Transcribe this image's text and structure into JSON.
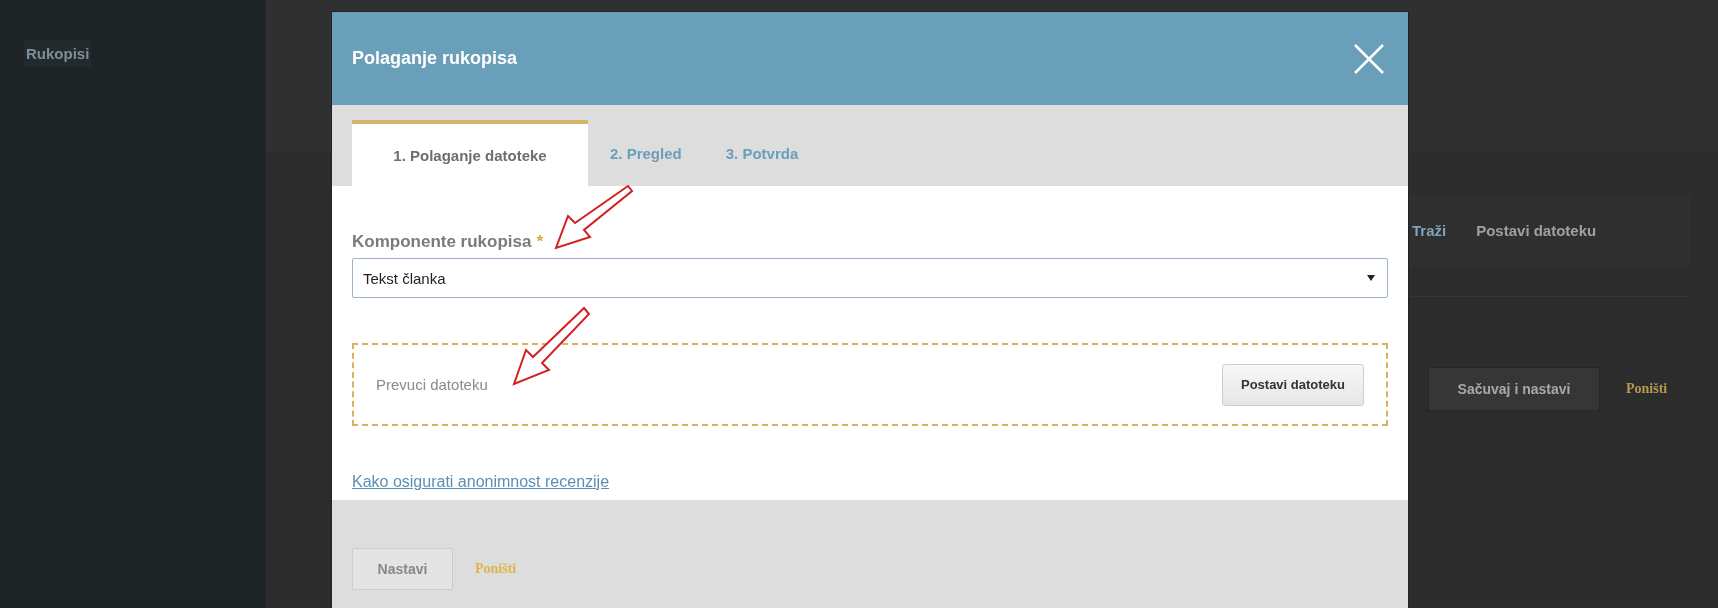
{
  "background": {
    "sidebar": {
      "title": "Rukopisi"
    },
    "toolbar": [
      "Traži",
      "Postavi datoteku"
    ],
    "save_button": "Sačuvaj i nastavi",
    "cancel_link": "Poništi"
  },
  "modal": {
    "title": "Polaganje rukopisa",
    "tabs": [
      {
        "label": "1. Polaganje datoteke",
        "selected": true
      },
      {
        "label": "2. Pregled",
        "selected": false
      },
      {
        "label": "3. Potvrda",
        "selected": false
      }
    ],
    "field": {
      "label": "Komponente rukopisa",
      "required_mark": "*",
      "value": "Tekst članka"
    },
    "dropzone": {
      "text": "Prevuci datoteku",
      "button": "Postavi datoteku"
    },
    "link": "Kako osigurati anonimnost recenzije",
    "footer": {
      "primary": "Nastavi",
      "cancel": "Poništi"
    }
  }
}
